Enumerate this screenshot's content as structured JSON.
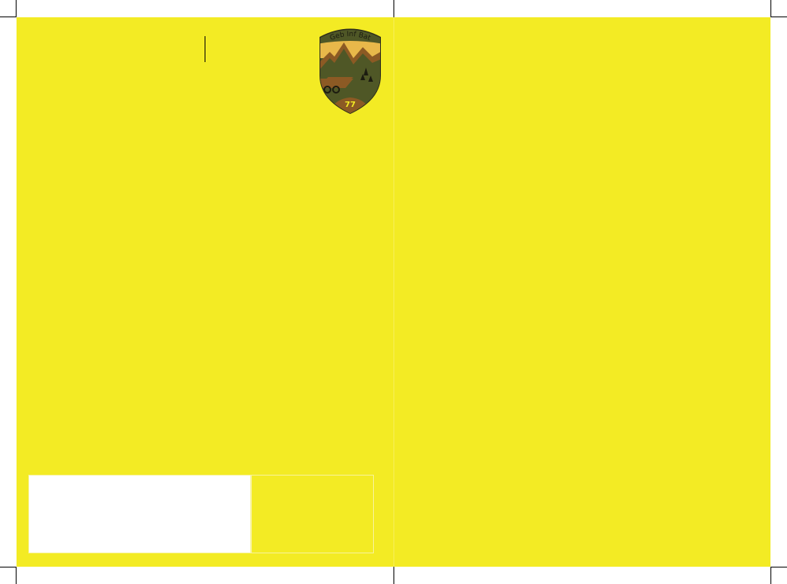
{
  "badge": {
    "unit_name": "Geb Inf Bat",
    "number": "77"
  },
  "colors": {
    "background": "#f3eb24",
    "badge_green": "#4f5726",
    "badge_brown": "#8c5a24",
    "badge_sky": "#e8b84a"
  }
}
